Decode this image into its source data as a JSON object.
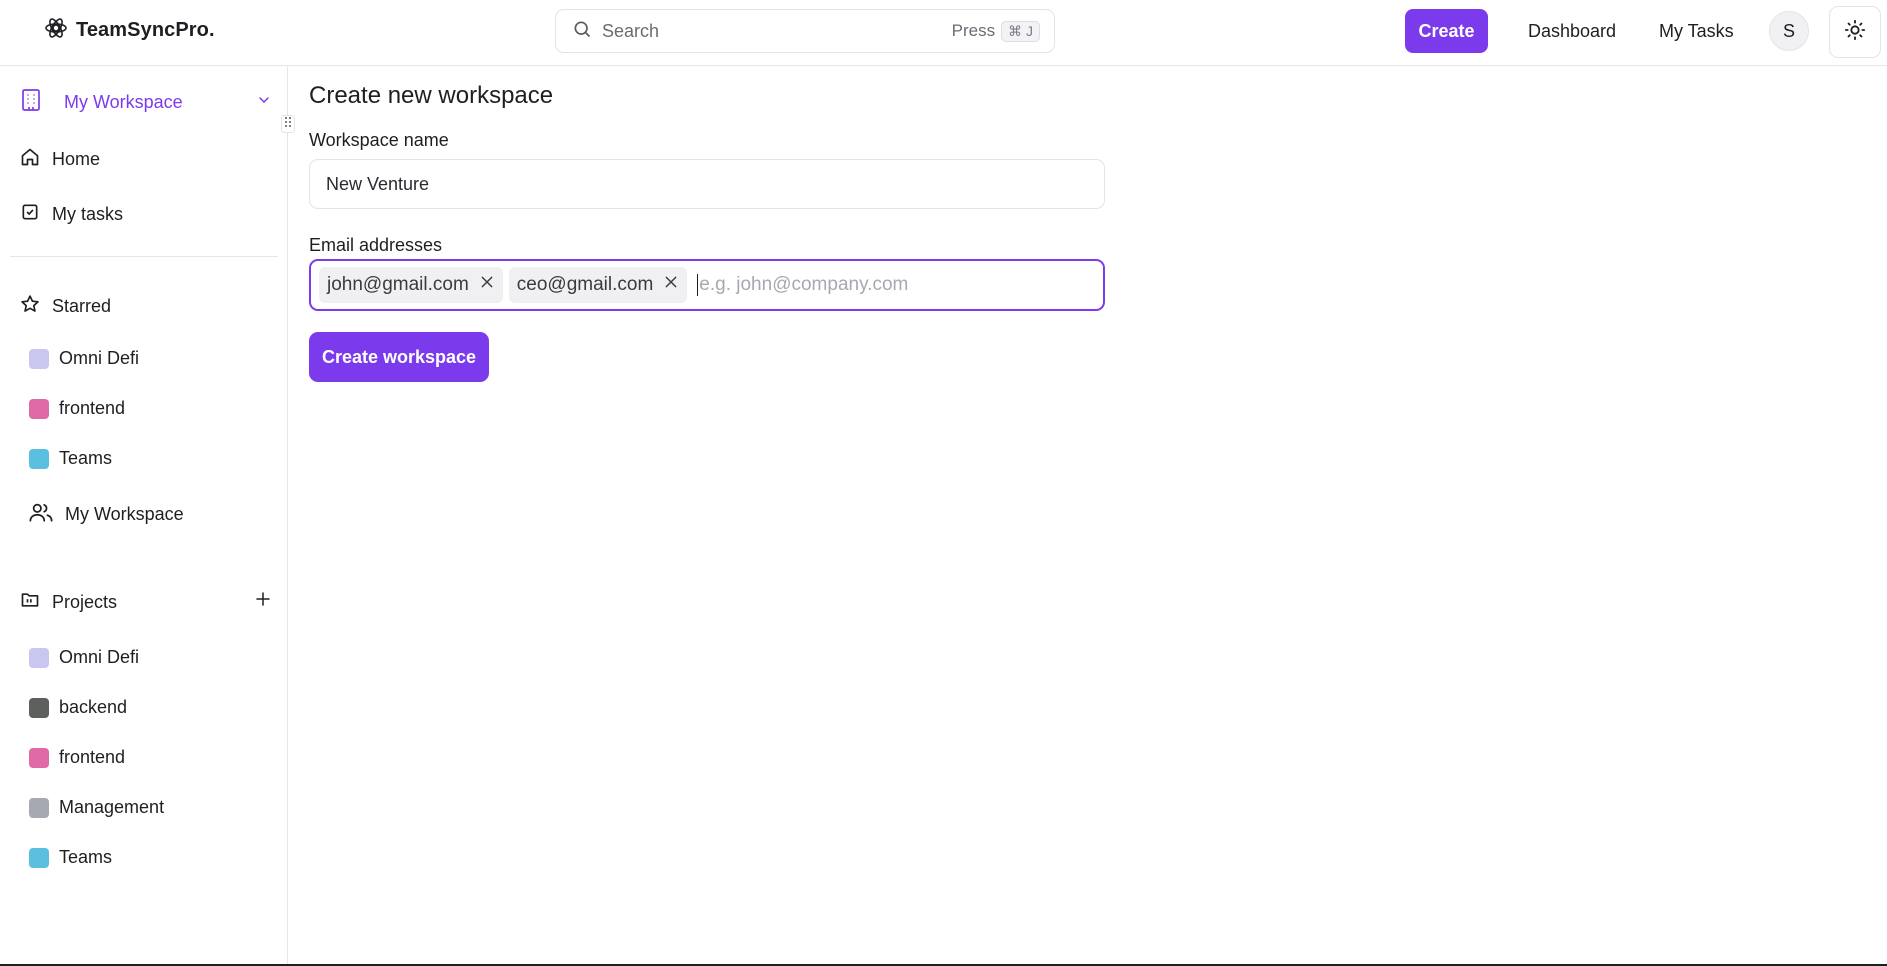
{
  "brand": {
    "name": "TeamSyncPro."
  },
  "search": {
    "label": "Search",
    "press": "Press",
    "shortcut": "⌘ J"
  },
  "header": {
    "create_label": "Create",
    "dashboard_label": "Dashboard",
    "my_tasks_label": "My Tasks",
    "avatar_initial": "S"
  },
  "sidebar": {
    "workspace_label": "My Workspace",
    "home_label": "Home",
    "my_tasks_label": "My tasks",
    "starred_label": "Starred",
    "starred_items": [
      {
        "label": "Omni Defi",
        "color": "#c9c6ef"
      },
      {
        "label": "frontend",
        "color": "#e06aa8"
      },
      {
        "label": "Teams",
        "color": "#5bbfdf"
      }
    ],
    "workspace_item_label": "My Workspace",
    "projects_label": "Projects",
    "project_items": [
      {
        "label": "Omni Defi",
        "color": "#c9c6ef"
      },
      {
        "label": "backend",
        "color": "#5d605d"
      },
      {
        "label": "frontend",
        "color": "#e06aa8"
      },
      {
        "label": "Management",
        "color": "#a6a8b2"
      },
      {
        "label": "Teams",
        "color": "#5bbfdf"
      }
    ]
  },
  "main": {
    "title": "Create new workspace",
    "name_label": "Workspace name",
    "name_value": "New Venture",
    "email_label": "Email addresses",
    "emails": [
      "john@gmail.com",
      "ceo@gmail.com"
    ],
    "email_placeholder": "e.g. john@company.com",
    "submit_label": "Create workspace"
  },
  "colors": {
    "accent": "#7c3aed"
  }
}
